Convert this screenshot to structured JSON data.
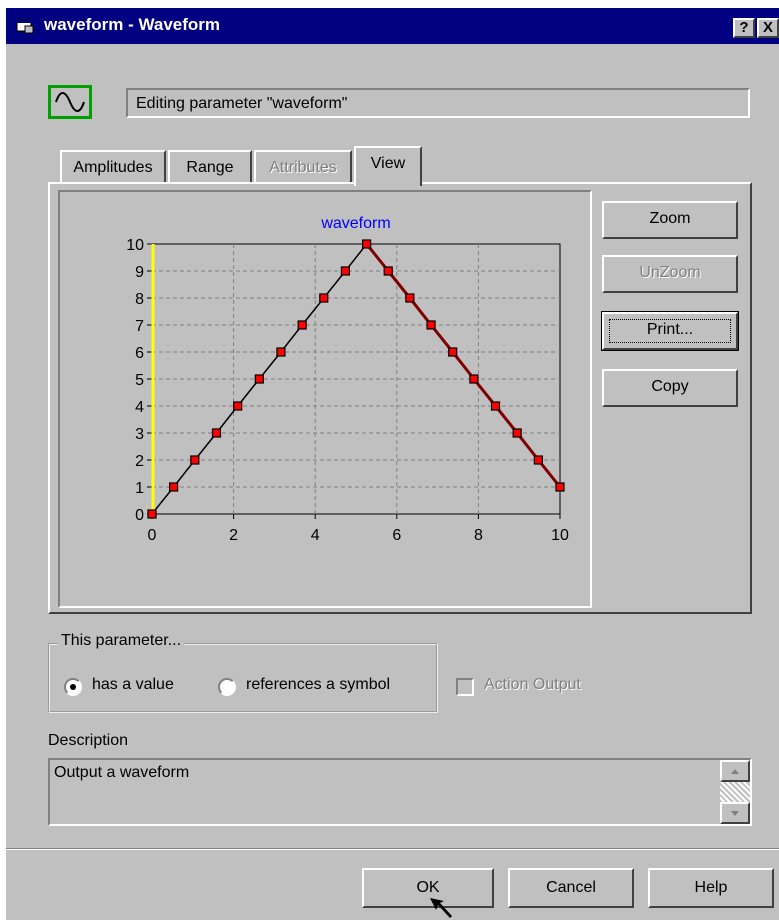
{
  "window": {
    "title": "waveform - Waveform",
    "help_label": "?",
    "close_label": "X"
  },
  "header": {
    "icon": "sine-wave-icon",
    "editing_text": "Editing parameter \"waveform\""
  },
  "tabs": [
    {
      "label": "Amplitudes",
      "enabled": true,
      "selected": false
    },
    {
      "label": "Range",
      "enabled": true,
      "selected": false
    },
    {
      "label": "Attributes",
      "enabled": false,
      "selected": false
    },
    {
      "label": "View",
      "enabled": true,
      "selected": true
    }
  ],
  "side_buttons": {
    "zoom": "Zoom",
    "unzoom": "UnZoom",
    "print": "Print...",
    "copy": "Copy"
  },
  "chart_data": {
    "type": "line",
    "title": "waveform",
    "xlabel": "",
    "ylabel": "",
    "xlim": [
      0,
      10
    ],
    "ylim": [
      0,
      10
    ],
    "x_ticks": [
      "0",
      "2",
      "4",
      "6",
      "8",
      "10"
    ],
    "y_ticks": [
      "0",
      "1",
      "2",
      "3",
      "4",
      "5",
      "6",
      "7",
      "8",
      "9",
      "10"
    ],
    "grid": true,
    "x": [
      0,
      0.53,
      1.05,
      1.58,
      2.1,
      2.63,
      3.16,
      3.68,
      4.21,
      4.74,
      5.26,
      5.79,
      6.32,
      6.84,
      7.37,
      7.89,
      8.42,
      8.95,
      9.47,
      10
    ],
    "y": [
      0,
      1,
      2,
      3,
      4,
      5,
      6,
      7,
      8,
      9,
      10,
      9,
      8,
      7,
      6,
      5,
      4,
      3,
      2,
      1
    ],
    "colors": {
      "line": "#000000",
      "marker": "#ff0000",
      "highlight": "#800000",
      "title": "#0000ff",
      "edge": "#ffff00"
    }
  },
  "parameter_group": {
    "title": "This parameter...",
    "option_value": "has a value",
    "option_symbol": "references a symbol",
    "selected": "value"
  },
  "action_output": {
    "label": "Action Output",
    "checked": false,
    "enabled": false
  },
  "description": {
    "label": "Description",
    "text": "Output a waveform"
  },
  "footer_buttons": {
    "ok": "OK",
    "cancel": "Cancel",
    "help": "Help"
  }
}
